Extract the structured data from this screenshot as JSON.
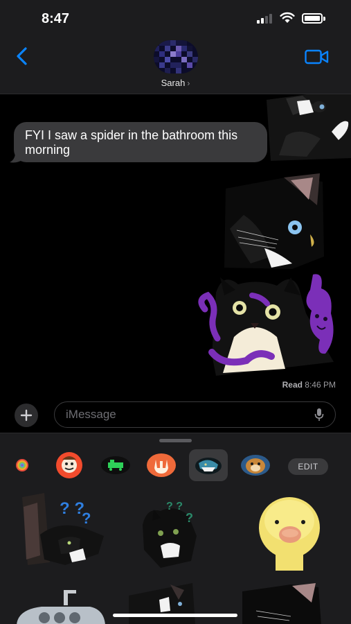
{
  "status_bar": {
    "time": "8:47"
  },
  "header": {
    "contact_name": "Sarah",
    "contact_chevron": "›",
    "back_icon": "chevron-left-icon",
    "video_icon": "video-camera-icon",
    "accent": "#0a84ff"
  },
  "conversation": {
    "received_message": "FYI I saw a spider in the bathroom this morning",
    "read_receipt_label": "Read",
    "read_receipt_time": "8:46 PM"
  },
  "compose": {
    "placeholder": "iMessage",
    "plus_label": "+"
  },
  "drawer": {
    "edit_label": "EDIT",
    "apps": [
      "photos-app-icon",
      "memoji-app-icon",
      "game-app-icon",
      "rock-gesture-app-icon",
      "cat-sticker-pack-icon",
      "dog-sticker-pack-icon"
    ],
    "selected_app": "cat-sticker-pack-icon"
  }
}
